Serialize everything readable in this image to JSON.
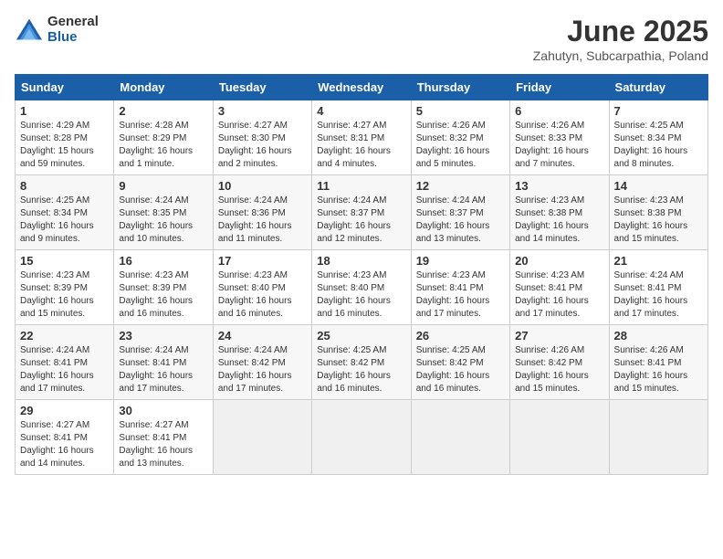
{
  "header": {
    "logo_general": "General",
    "logo_blue": "Blue",
    "month_title": "June 2025",
    "subtitle": "Zahutyn, Subcarpathia, Poland"
  },
  "weekdays": [
    "Sunday",
    "Monday",
    "Tuesday",
    "Wednesday",
    "Thursday",
    "Friday",
    "Saturday"
  ],
  "weeks": [
    [
      {
        "day": "1",
        "sunrise": "4:29 AM",
        "sunset": "8:28 PM",
        "daylight": "15 hours and 59 minutes."
      },
      {
        "day": "2",
        "sunrise": "4:28 AM",
        "sunset": "8:29 PM",
        "daylight": "16 hours and 1 minute."
      },
      {
        "day": "3",
        "sunrise": "4:27 AM",
        "sunset": "8:30 PM",
        "daylight": "16 hours and 2 minutes."
      },
      {
        "day": "4",
        "sunrise": "4:27 AM",
        "sunset": "8:31 PM",
        "daylight": "16 hours and 4 minutes."
      },
      {
        "day": "5",
        "sunrise": "4:26 AM",
        "sunset": "8:32 PM",
        "daylight": "16 hours and 5 minutes."
      },
      {
        "day": "6",
        "sunrise": "4:26 AM",
        "sunset": "8:33 PM",
        "daylight": "16 hours and 7 minutes."
      },
      {
        "day": "7",
        "sunrise": "4:25 AM",
        "sunset": "8:34 PM",
        "daylight": "16 hours and 8 minutes."
      }
    ],
    [
      {
        "day": "8",
        "sunrise": "4:25 AM",
        "sunset": "8:34 PM",
        "daylight": "16 hours and 9 minutes."
      },
      {
        "day": "9",
        "sunrise": "4:24 AM",
        "sunset": "8:35 PM",
        "daylight": "16 hours and 10 minutes."
      },
      {
        "day": "10",
        "sunrise": "4:24 AM",
        "sunset": "8:36 PM",
        "daylight": "16 hours and 11 minutes."
      },
      {
        "day": "11",
        "sunrise": "4:24 AM",
        "sunset": "8:37 PM",
        "daylight": "16 hours and 12 minutes."
      },
      {
        "day": "12",
        "sunrise": "4:24 AM",
        "sunset": "8:37 PM",
        "daylight": "16 hours and 13 minutes."
      },
      {
        "day": "13",
        "sunrise": "4:23 AM",
        "sunset": "8:38 PM",
        "daylight": "16 hours and 14 minutes."
      },
      {
        "day": "14",
        "sunrise": "4:23 AM",
        "sunset": "8:38 PM",
        "daylight": "16 hours and 15 minutes."
      }
    ],
    [
      {
        "day": "15",
        "sunrise": "4:23 AM",
        "sunset": "8:39 PM",
        "daylight": "16 hours and 15 minutes."
      },
      {
        "day": "16",
        "sunrise": "4:23 AM",
        "sunset": "8:39 PM",
        "daylight": "16 hours and 16 minutes."
      },
      {
        "day": "17",
        "sunrise": "4:23 AM",
        "sunset": "8:40 PM",
        "daylight": "16 hours and 16 minutes."
      },
      {
        "day": "18",
        "sunrise": "4:23 AM",
        "sunset": "8:40 PM",
        "daylight": "16 hours and 16 minutes."
      },
      {
        "day": "19",
        "sunrise": "4:23 AM",
        "sunset": "8:41 PM",
        "daylight": "16 hours and 17 minutes."
      },
      {
        "day": "20",
        "sunrise": "4:23 AM",
        "sunset": "8:41 PM",
        "daylight": "16 hours and 17 minutes."
      },
      {
        "day": "21",
        "sunrise": "4:24 AM",
        "sunset": "8:41 PM",
        "daylight": "16 hours and 17 minutes."
      }
    ],
    [
      {
        "day": "22",
        "sunrise": "4:24 AM",
        "sunset": "8:41 PM",
        "daylight": "16 hours and 17 minutes."
      },
      {
        "day": "23",
        "sunrise": "4:24 AM",
        "sunset": "8:41 PM",
        "daylight": "16 hours and 17 minutes."
      },
      {
        "day": "24",
        "sunrise": "4:24 AM",
        "sunset": "8:42 PM",
        "daylight": "16 hours and 17 minutes."
      },
      {
        "day": "25",
        "sunrise": "4:25 AM",
        "sunset": "8:42 PM",
        "daylight": "16 hours and 16 minutes."
      },
      {
        "day": "26",
        "sunrise": "4:25 AM",
        "sunset": "8:42 PM",
        "daylight": "16 hours and 16 minutes."
      },
      {
        "day": "27",
        "sunrise": "4:26 AM",
        "sunset": "8:42 PM",
        "daylight": "16 hours and 15 minutes."
      },
      {
        "day": "28",
        "sunrise": "4:26 AM",
        "sunset": "8:41 PM",
        "daylight": "16 hours and 15 minutes."
      }
    ],
    [
      {
        "day": "29",
        "sunrise": "4:27 AM",
        "sunset": "8:41 PM",
        "daylight": "16 hours and 14 minutes."
      },
      {
        "day": "30",
        "sunrise": "4:27 AM",
        "sunset": "8:41 PM",
        "daylight": "16 hours and 13 minutes."
      },
      null,
      null,
      null,
      null,
      null
    ]
  ]
}
